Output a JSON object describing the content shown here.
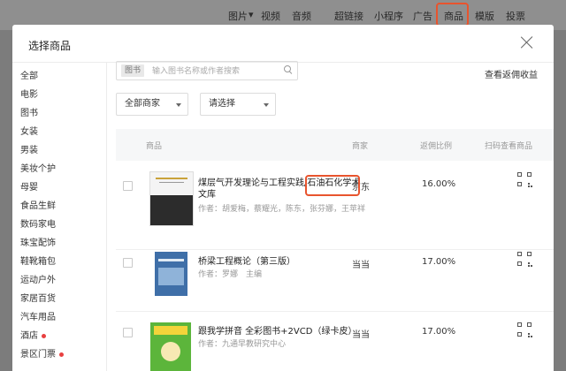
{
  "toolbar": {
    "items": [
      "图片",
      "视频",
      "音频",
      "超链接",
      "小程序",
      "广告",
      "商品",
      "模版",
      "投票"
    ],
    "active": "商品"
  },
  "modal": {
    "title": "选择商品",
    "close_icon": "close-icon"
  },
  "sidebar": {
    "items": [
      {
        "label": "全部",
        "dot": false
      },
      {
        "label": "电影",
        "dot": false
      },
      {
        "label": "图书",
        "dot": false
      },
      {
        "label": "女装",
        "dot": false
      },
      {
        "label": "男装",
        "dot": false
      },
      {
        "label": "美妆个护",
        "dot": false
      },
      {
        "label": "母婴",
        "dot": false
      },
      {
        "label": "食品生鲜",
        "dot": false
      },
      {
        "label": "数码家电",
        "dot": false
      },
      {
        "label": "珠宝配饰",
        "dot": false
      },
      {
        "label": "鞋靴箱包",
        "dot": false
      },
      {
        "label": "运动户外",
        "dot": false
      },
      {
        "label": "家居百货",
        "dot": false
      },
      {
        "label": "汽车用品",
        "dot": false
      },
      {
        "label": "酒店",
        "dot": true
      },
      {
        "label": "景区门票",
        "dot": true
      }
    ],
    "dot_color": "#e84040"
  },
  "search": {
    "tag": "图书",
    "placeholder": "输入图书名称或作者搜索",
    "value": ""
  },
  "revenue_link": "查看返佣收益",
  "filters": {
    "merchant": "全部商家",
    "select": "请选择"
  },
  "table": {
    "columns": [
      "商品",
      "商家",
      "返佣比例",
      "扫码查看商品"
    ],
    "rows": [
      {
        "title": "煤层气开发理论与工程实践/石油石化学术文库",
        "authors": "作者：胡爱梅，蔡耀光，陈东，张芬娜，王苹祥",
        "merchant": "京东",
        "ratio": "16.00%",
        "cover_colors": [
          "#f4f4f4",
          "#2c2c2c"
        ]
      },
      {
        "title": "桥梁工程概论（第三版）",
        "authors": "作者：罗娜　主编",
        "merchant": "当当",
        "ratio": "17.00%",
        "cover_colors": [
          "#3f6fa8",
          "#dfe9f3"
        ]
      },
      {
        "title": "跟我学拼音 全彩图书+2VCD（绿卡皮）",
        "authors": "作者：九通早教研究中心",
        "merchant": "当当",
        "ratio": "17.00%",
        "cover_colors": [
          "#5cb53b",
          "#f3d43a"
        ]
      }
    ]
  },
  "accent_color": "#e8542e"
}
